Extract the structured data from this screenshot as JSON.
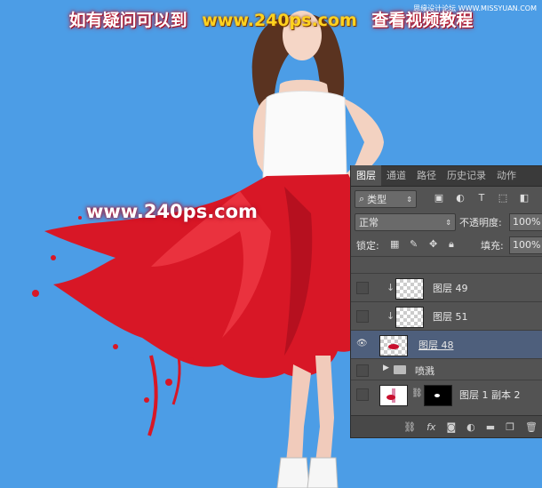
{
  "banner": {
    "left": "如有疑问可以到",
    "site": "www.240ps.com",
    "right": "查看视频教程",
    "corner": "思缘设计论坛 WWW.MISSYUAN.COM"
  },
  "watermark": "www.240ps.com",
  "layers_panel": {
    "tabs": [
      "图层",
      "通道",
      "路径",
      "历史记录",
      "动作"
    ],
    "active_tab": "图层",
    "filter_label": "类型",
    "blend_mode": "正常",
    "opacity_label": "不透明度:",
    "opacity_value": "100%",
    "lock_label": "锁定:",
    "fill_label": "填充:",
    "fill_value": "100%",
    "layers": [
      {
        "name": "图层 49",
        "visible": false,
        "clipped": true
      },
      {
        "name": "图层 51",
        "visible": false,
        "clipped": true
      },
      {
        "name": "图层 48",
        "visible": true,
        "selected": true
      },
      {
        "name": "喷溅",
        "visible": false,
        "group": true
      },
      {
        "name": "图层 1 副本 2",
        "visible": false,
        "has_mask": true
      }
    ],
    "footer_icons": [
      "link-icon",
      "fx-icon",
      "mask-icon",
      "adjustment-icon",
      "group-icon",
      "new-layer-icon",
      "trash-icon"
    ]
  },
  "colors": {
    "background": "#4c9de6",
    "panel": "#535353",
    "selected_layer": "#4e5f7c"
  }
}
